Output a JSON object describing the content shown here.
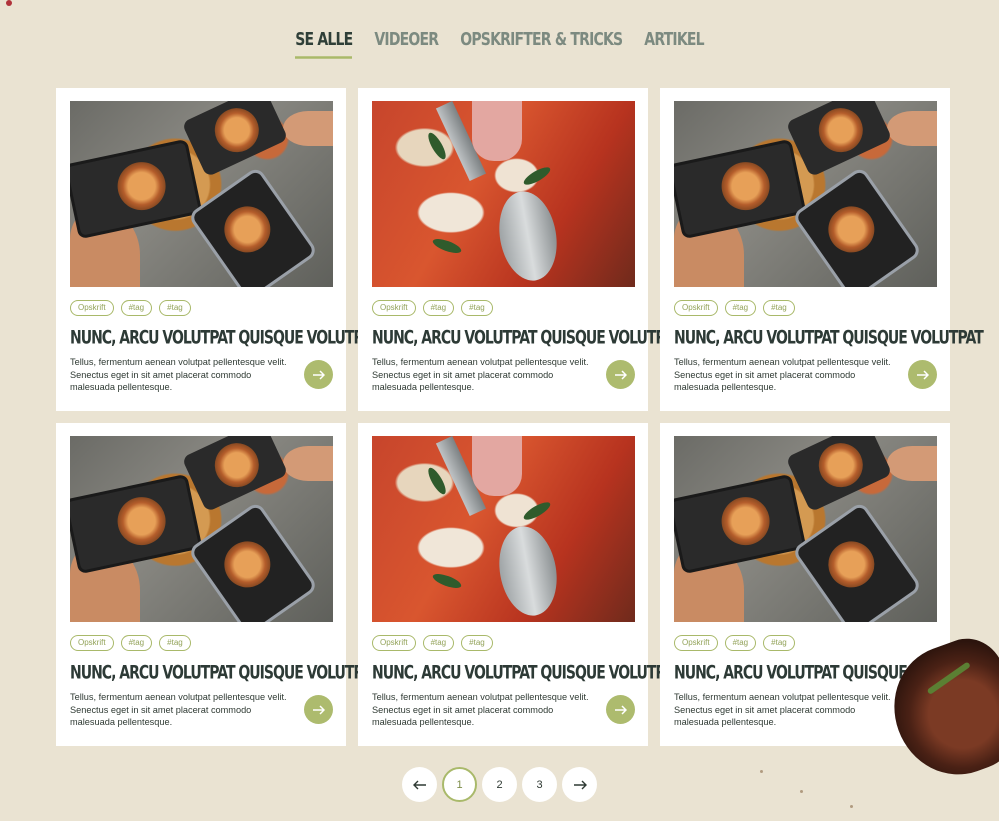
{
  "tabs": [
    {
      "label": "SE ALLE",
      "active": true
    },
    {
      "label": "VIDEOER",
      "active": false
    },
    {
      "label": "OPSKRIFTER & TRICKS",
      "active": false
    },
    {
      "label": "ARTIKEL",
      "active": false
    }
  ],
  "cards": [
    {
      "image": "phones-pizza",
      "tags": [
        "Opskrift",
        "#tag",
        "#tag"
      ],
      "title": "NUNC, ARCU VOLUTPAT QUISQUE VOLUTPAT",
      "description": "Tellus, fermentum aenean volutpat pellentesque velit. Senectus eget in sit amet placerat commodo malesuada pellentesque."
    },
    {
      "image": "pizza-cutter",
      "tags": [
        "Opskrift",
        "#tag",
        "#tag"
      ],
      "title": "NUNC, ARCU VOLUTPAT QUISQUE VOLUTPAT",
      "description": "Tellus, fermentum aenean volutpat pellentesque velit. Senectus eget in sit amet placerat commodo malesuada pellentesque."
    },
    {
      "image": "phones-pizza",
      "tags": [
        "Opskrift",
        "#tag",
        "#tag"
      ],
      "title": "NUNC, ARCU VOLUTPAT QUISQUE VOLUTPAT",
      "description": "Tellus, fermentum aenean volutpat pellentesque velit. Senectus eget in sit amet placerat commodo malesuada pellentesque."
    },
    {
      "image": "phones-pizza",
      "tags": [
        "Opskrift",
        "#tag",
        "#tag"
      ],
      "title": "NUNC, ARCU VOLUTPAT QUISQUE VOLUTPAT",
      "description": "Tellus, fermentum aenean volutpat pellentesque velit. Senectus eget in sit amet placerat commodo malesuada pellentesque."
    },
    {
      "image": "pizza-cutter",
      "tags": [
        "Opskrift",
        "#tag",
        "#tag"
      ],
      "title": "NUNC, ARCU VOLUTPAT QUISQUE VOLUTPAT",
      "description": "Tellus, fermentum aenean volutpat pellentesque velit. Senectus eget in sit amet placerat commodo malesuada pellentesque."
    },
    {
      "image": "phones-pizza",
      "tags": [
        "Opskrift",
        "#tag",
        "#tag"
      ],
      "title": "NUNC, ARCU VOLUTPAT QUISQUE VOLUTPAT",
      "description": "Tellus, fermentum aenean volutpat pellentesque velit. Senectus eget in sit amet placerat commodo malesuada pellentesque."
    }
  ],
  "card_button_icon": "arrow-right-icon",
  "pagination": {
    "prev_icon": "arrow-left-icon",
    "pages": [
      "1",
      "2",
      "3"
    ],
    "current": "1",
    "next_icon": "arrow-right-icon"
  },
  "colors": {
    "background": "#eae3d2",
    "accent": "#adbb6e",
    "title": "#2d3a36"
  }
}
